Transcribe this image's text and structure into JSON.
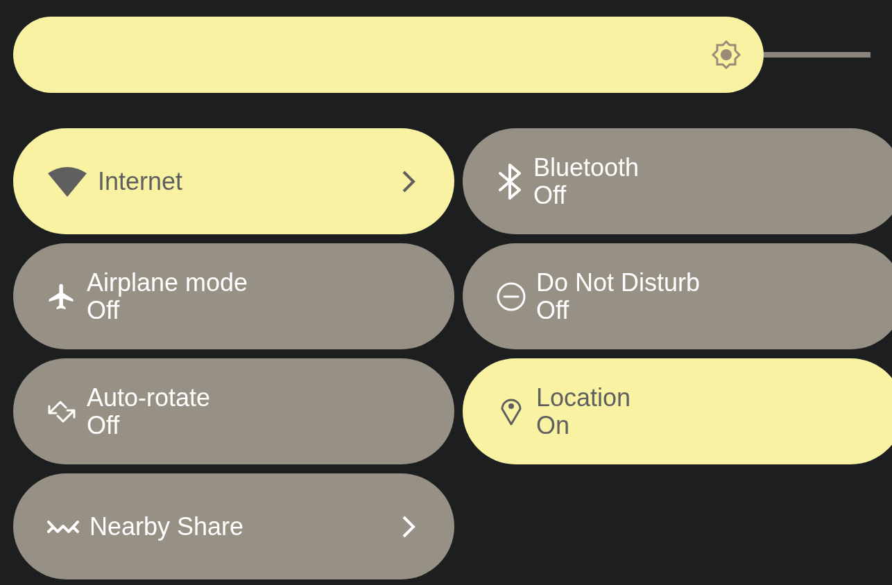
{
  "brightness": {
    "level": 0.875
  },
  "tiles": [
    {
      "label": "Internet",
      "on": true,
      "chevron": true
    },
    {
      "label": "Bluetooth",
      "secondary": "Off",
      "on": false,
      "chevron": false
    },
    {
      "label": "Airplane mode",
      "secondary": "Off",
      "on": false,
      "chevron": false
    },
    {
      "label": "Do Not Disturb",
      "secondary": "Off",
      "on": false,
      "chevron": false
    },
    {
      "label": "Auto-rotate",
      "secondary": "Off",
      "on": false,
      "chevron": false
    },
    {
      "label": "Location",
      "secondary": "On",
      "on": true,
      "chevron": false
    },
    {
      "label": "Nearby Share",
      "on": false,
      "chevron": true
    }
  ]
}
